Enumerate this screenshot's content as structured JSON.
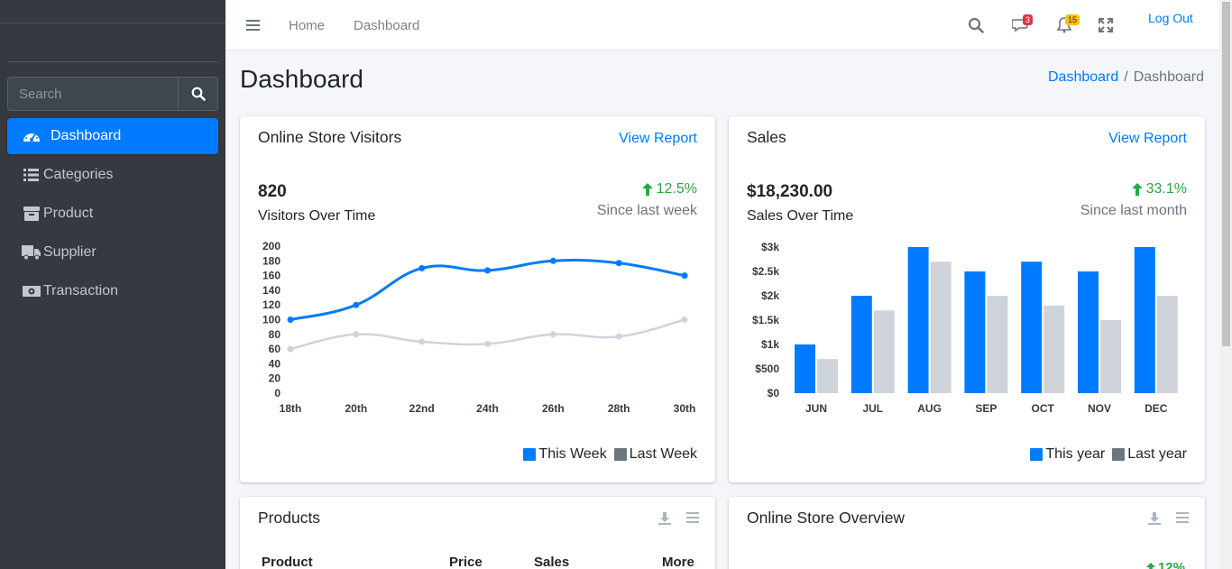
{
  "sidebar": {
    "search_placeholder": "Search",
    "items": [
      {
        "label": "Dashboard",
        "icon": "tachometer-icon",
        "active": true
      },
      {
        "label": "Categories",
        "icon": "list-icon"
      },
      {
        "label": "Product",
        "icon": "box-icon"
      },
      {
        "label": "Supplier",
        "icon": "truck-icon"
      },
      {
        "label": "Transaction",
        "icon": "money-bill-icon"
      }
    ]
  },
  "topbar": {
    "home": "Home",
    "dashboard": "Dashboard",
    "messages_count": "3",
    "notifications_count": "15",
    "logout": "Log Out"
  },
  "header": {
    "title": "Dashboard",
    "breadcrumb": [
      "Dashboard",
      "Dashboard"
    ]
  },
  "visitors": {
    "title": "Online Store Visitors",
    "link": "View Report",
    "value": "820",
    "sub_label": "Visitors Over Time",
    "pct": "12.5%",
    "since": "Since last week",
    "legend": [
      "This Week",
      "Last Week"
    ]
  },
  "sales": {
    "title": "Sales",
    "link": "View Report",
    "value": "$18,230.00",
    "sub_label": "Sales Over Time",
    "pct": "33.1%",
    "since": "Since last month",
    "legend": [
      "This year",
      "Last year"
    ]
  },
  "products": {
    "title": "Products",
    "columns": [
      "Product",
      "Price",
      "Sales",
      "More"
    ]
  },
  "overview": {
    "title": "Online Store Overview",
    "pct": "12%"
  },
  "colors": {
    "primary": "#007bff",
    "gray": "#ced4da",
    "legend_gray": "#6c757d",
    "success": "#28a745"
  },
  "chart_data": [
    {
      "type": "line",
      "x": [
        "18th",
        "20th",
        "22nd",
        "24th",
        "26th",
        "28th",
        "30th"
      ],
      "ylim": [
        0,
        200
      ],
      "yticks": [
        0,
        20,
        40,
        60,
        80,
        100,
        120,
        140,
        160,
        180,
        200
      ],
      "series": [
        {
          "name": "This Week",
          "values": [
            100,
            120,
            170,
            167,
            180,
            177,
            160
          ]
        },
        {
          "name": "Last Week",
          "values": [
            60,
            80,
            70,
            67,
            80,
            77,
            100
          ]
        }
      ],
      "legend": "bottom-right"
    },
    {
      "type": "bar",
      "categories": [
        "JUN",
        "JUL",
        "AUG",
        "SEP",
        "OCT",
        "NOV",
        "DEC"
      ],
      "ylim": [
        0,
        3000
      ],
      "yticks": [
        "$0",
        "$500",
        "$1k",
        "$1.5k",
        "$2k",
        "$2.5k",
        "$3k"
      ],
      "series": [
        {
          "name": "This year",
          "values": [
            1000,
            2000,
            3000,
            2500,
            2700,
            2500,
            3000
          ]
        },
        {
          "name": "Last year",
          "values": [
            700,
            1700,
            2700,
            2000,
            1800,
            1500,
            2000
          ]
        }
      ],
      "legend": "bottom-right"
    }
  ]
}
